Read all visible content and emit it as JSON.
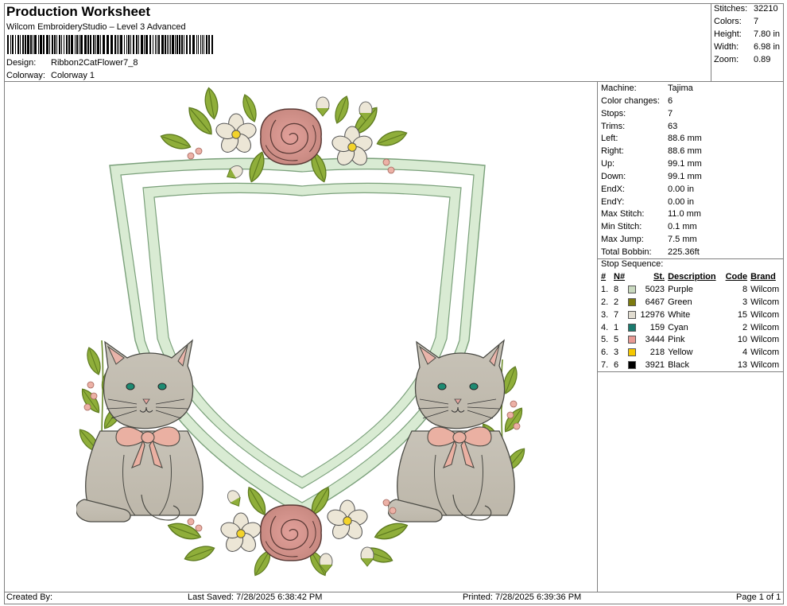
{
  "header": {
    "title": "Production Worksheet",
    "software": "Wilcom EmbroideryStudio – Level 3 Advanced",
    "design_label": "Design:",
    "design_value": "Ribbon2CatFlower7_8",
    "colorway_label": "Colorway:",
    "colorway_value": "Colorway 1"
  },
  "summary": [
    {
      "label": "Stitches:",
      "value": "32210"
    },
    {
      "label": "Colors:",
      "value": "7"
    },
    {
      "label": "Height:",
      "value": "7.80 in"
    },
    {
      "label": "Width:",
      "value": "6.98 in"
    },
    {
      "label": "Zoom:",
      "value": "0.89"
    }
  ],
  "machine_info": [
    {
      "label": "Machine:",
      "value": "Tajima"
    },
    {
      "label": "Color changes:",
      "value": "6"
    },
    {
      "label": "Stops:",
      "value": "7"
    },
    {
      "label": "Trims:",
      "value": "63"
    },
    {
      "label": "Left:",
      "value": "88.6 mm"
    },
    {
      "label": "Right:",
      "value": "88.6 mm"
    },
    {
      "label": "Up:",
      "value": "99.1 mm"
    },
    {
      "label": "Down:",
      "value": "99.1 mm"
    },
    {
      "label": "EndX:",
      "value": "0.00 in"
    },
    {
      "label": "EndY:",
      "value": "0.00 in"
    },
    {
      "label": "Max Stitch:",
      "value": "11.0 mm"
    },
    {
      "label": "Min Stitch:",
      "value": "0.1 mm"
    },
    {
      "label": "Max Jump:",
      "value": "7.5 mm"
    },
    {
      "label": "Total Bobbin:",
      "value": "225.36ft"
    }
  ],
  "stop_sequence": {
    "title": "Stop Sequence:",
    "headers": [
      "#",
      "N#",
      "St.",
      "Description",
      "Code",
      "Brand"
    ],
    "rows": [
      {
        "idx": "1.",
        "n": "8",
        "color": "#c9d9bf",
        "st": "5023",
        "desc": "Purple",
        "code": "8",
        "brand": "Wilcom"
      },
      {
        "idx": "2.",
        "n": "2",
        "color": "#7c7a0f",
        "st": "6467",
        "desc": "Green",
        "code": "3",
        "brand": "Wilcom"
      },
      {
        "idx": "3.",
        "n": "7",
        "color": "#e1dcd0",
        "st": "12976",
        "desc": "White",
        "code": "15",
        "brand": "Wilcom"
      },
      {
        "idx": "4.",
        "n": "1",
        "color": "#1a7a6e",
        "st": "159",
        "desc": "Cyan",
        "code": "2",
        "brand": "Wilcom"
      },
      {
        "idx": "5.",
        "n": "5",
        "color": "#e89a94",
        "st": "3444",
        "desc": "Pink",
        "code": "10",
        "brand": "Wilcom"
      },
      {
        "idx": "6.",
        "n": "3",
        "color": "#f5c800",
        "st": "218",
        "desc": "Yellow",
        "code": "4",
        "brand": "Wilcom"
      },
      {
        "idx": "7.",
        "n": "6",
        "color": "#000000",
        "st": "3921",
        "desc": "Black",
        "code": "13",
        "brand": "Wilcom"
      }
    ]
  },
  "footer": {
    "created": "Created By:",
    "saved": "Last Saved: 7/28/2025 6:38:42 PM",
    "printed": "Printed: 7/28/2025 6:39:36 PM",
    "page": "Page 1 of 1"
  }
}
